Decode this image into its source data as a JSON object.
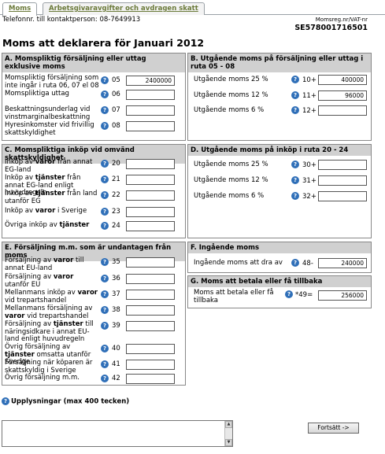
{
  "tabs": [
    "Moms",
    "Arbetsgivaravgifter och avdragen skatt"
  ],
  "contact": "Telefonnr. till kontaktperson: 08-7649913",
  "orgno_label": "Momsreg.nr/VAT-nr",
  "orgno": "SE578001716501",
  "page_title": "Moms att deklarera för Januari 2012",
  "sections": {
    "A": {
      "title": "A. Momspliktig försäljning eller uttag exklusive moms",
      "rows": [
        {
          "label": "Momspliktig försäljning som inte ingår i ruta 06, 07 el 08",
          "box": "05",
          "value": "2400000"
        },
        {
          "label": "Momspliktiga uttag",
          "box": "06",
          "value": ""
        },
        {
          "label": "Beskattningsunderlag vid vinstmarginalbeskattning",
          "box": "07",
          "value": ""
        },
        {
          "label": "Hyresinkomster vid frivillig skattskyldighet",
          "box": "08",
          "value": ""
        }
      ]
    },
    "B": {
      "title": "B. Utgående moms på försäljning eller uttag i ruta 05 - 08",
      "rows": [
        {
          "label": "Utgående moms 25 %",
          "box": "10+",
          "value": "400000"
        },
        {
          "label": "Utgående moms 12 %",
          "box": "11+",
          "value": "96000"
        },
        {
          "label": "Utgående moms 6 %",
          "box": "12+",
          "value": ""
        }
      ]
    },
    "C": {
      "title": "C. Momspliktiga inköp vid omvänd skattskyldighet",
      "rows": [
        {
          "pre": "Inköp av ",
          "bold": "varor",
          "post": " från annat EG-land",
          "box": "20",
          "value": ""
        },
        {
          "pre": "Inköp av ",
          "bold": "tjänster",
          "post": " från annat EG-land enligt huvudregeln",
          "box": "21",
          "value": ""
        },
        {
          "pre": "Inköp av ",
          "bold": "tjänster",
          "post": " från land utanför EG",
          "box": "22",
          "value": ""
        },
        {
          "pre": "Inköp av ",
          "bold": "varor",
          "post": " i Sverige",
          "box": "23",
          "value": ""
        },
        {
          "pre": "Övriga inköp av ",
          "bold": "tjänster",
          "post": "",
          "box": "24",
          "value": ""
        }
      ]
    },
    "D": {
      "title": "D. Utgående moms på inköp i ruta 20 - 24",
      "rows": [
        {
          "label": "Utgående moms 25 %",
          "box": "30+",
          "value": ""
        },
        {
          "label": "Utgående moms 12 %",
          "box": "31+",
          "value": ""
        },
        {
          "label": "Utgående moms 6 %",
          "box": "32+",
          "value": ""
        }
      ]
    },
    "E": {
      "title": "E. Försäljning m.m. som är undantagen från moms",
      "rows": [
        {
          "pre": "Försäljning av ",
          "bold": "varor",
          "post": " till annat EU-land",
          "box": "35",
          "value": ""
        },
        {
          "pre": "Försäljning av ",
          "bold": "varor",
          "post": " utanför EU",
          "box": "36",
          "value": ""
        },
        {
          "pre": "Mellanmans inköp av ",
          "bold": "varor",
          "post": " vid trepartshandel",
          "box": "37",
          "value": ""
        },
        {
          "pre": "Mellanmans försäljning av ",
          "bold": "varor",
          "post": " vid trepartshandel",
          "box": "38",
          "value": ""
        },
        {
          "pre": "Försäljning av ",
          "bold": "tjänster",
          "post": " till näringsidkare i annat EU-land enligt huvudregeln",
          "box": "39",
          "value": ""
        },
        {
          "pre": "Övrig försäljning av ",
          "bold": "tjänster",
          "post": " omsatta utanför Sverige",
          "box": "40",
          "value": ""
        },
        {
          "pre": "Försäljning när köparen är skattskyldig i Sverige",
          "bold": "",
          "post": "",
          "box": "41",
          "value": ""
        },
        {
          "pre": "Övrig försäljning m.m.",
          "bold": "",
          "post": "",
          "box": "42",
          "value": ""
        }
      ]
    },
    "F": {
      "title": "F. Ingående moms",
      "rows": [
        {
          "label": "Ingående moms att dra av",
          "box": "48-",
          "value": "240000"
        }
      ]
    },
    "G": {
      "title": "G. Moms att betala eller få tillbaka",
      "rows": [
        {
          "label": "Moms att betala eller få tillbaka",
          "box": "*49=",
          "value": "256000"
        }
      ]
    }
  },
  "info_label": "Upplysningar (max 400 tecken)",
  "continue_button": "Fortsätt ->",
  "help_icon_glyph": "?"
}
